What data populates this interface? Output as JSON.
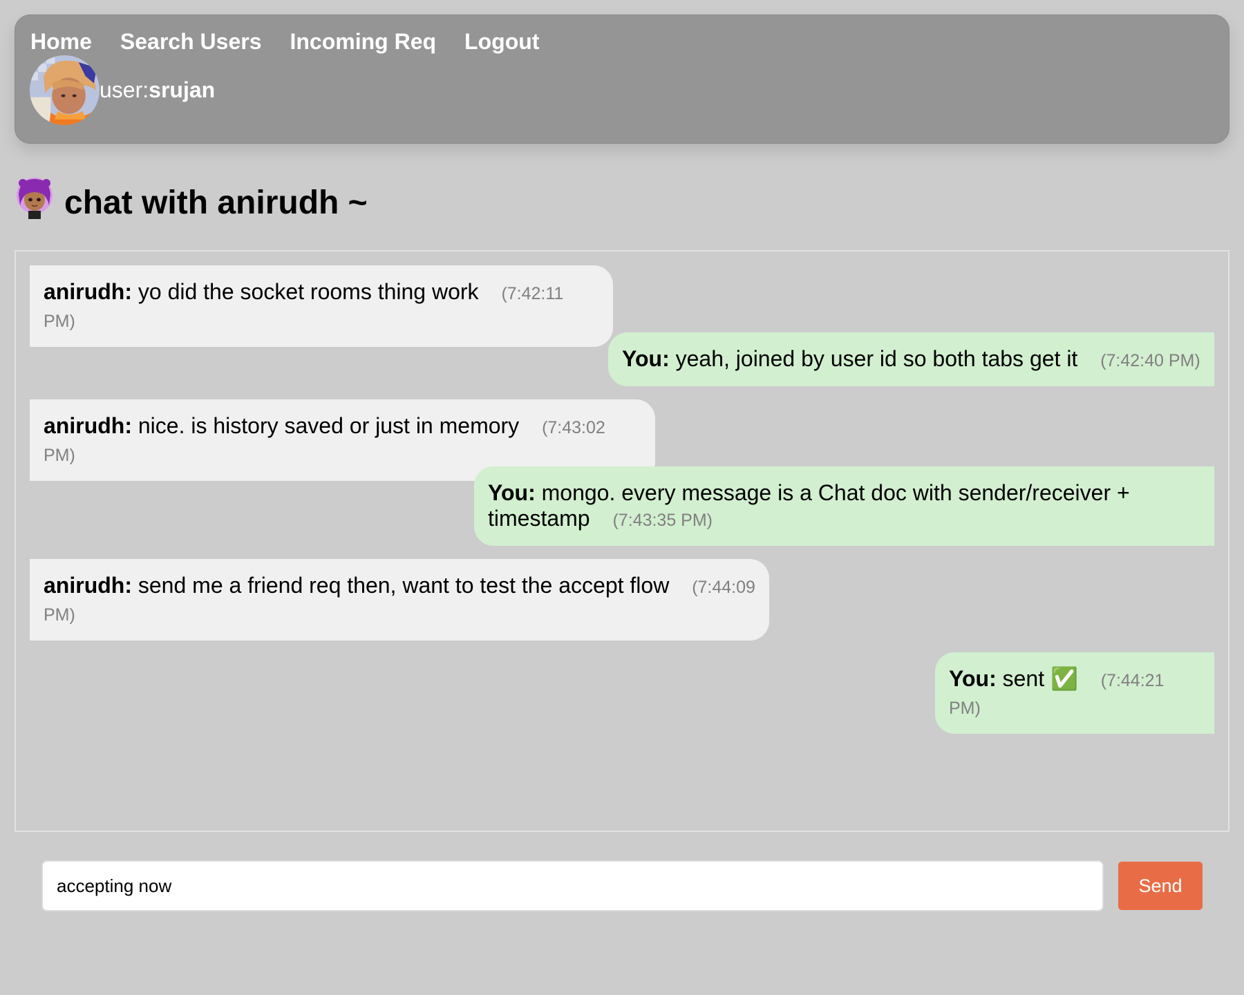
{
  "nav": {
    "links": [
      {
        "label": "Home"
      },
      {
        "label": "Search Users"
      },
      {
        "label": "Incoming Req"
      },
      {
        "label": "Logout"
      }
    ],
    "user_prefix": "user:",
    "username": "srujan"
  },
  "chat": {
    "title": "chat with anirudh ~",
    "messages": [
      {
        "sender": "anirudh:",
        "text": "yo did the socket rooms thing work",
        "time": "(7:42:11 PM)",
        "direction": "incoming"
      },
      {
        "sender": "You:",
        "text": "yeah, joined by user id so both tabs get it",
        "time": "(7:42:40 PM)",
        "direction": "outgoing"
      },
      {
        "sender": "anirudh:",
        "text": "nice. is history saved or just in memory",
        "time": "(7:43:02 PM)",
        "direction": "incoming"
      },
      {
        "sender": "You:",
        "text": "mongo. every message is a Chat doc with sender/receiver + timestamp",
        "time": "(7:43:35 PM)",
        "direction": "outgoing"
      },
      {
        "sender": "anirudh:",
        "text": "send me a friend req then, want to test the accept flow",
        "time": "(7:44:09 PM)",
        "direction": "incoming"
      },
      {
        "sender": "You:",
        "text": "sent ✅",
        "time": "(7:44:21 PM)",
        "direction": "outgoing"
      }
    ]
  },
  "composer": {
    "value": "accepting now",
    "send_label": "Send"
  },
  "colors": {
    "page_bg": "#cccccc",
    "navbar_bg": "#959595",
    "incoming_bubble": "#f0f0f0",
    "outgoing_bubble": "#d2efd0",
    "send_button": "#e86d46"
  },
  "icons": {
    "user_avatar": "anime-avatar-orange-hair",
    "contact_avatar": "purple-hair-girl-avatar"
  }
}
